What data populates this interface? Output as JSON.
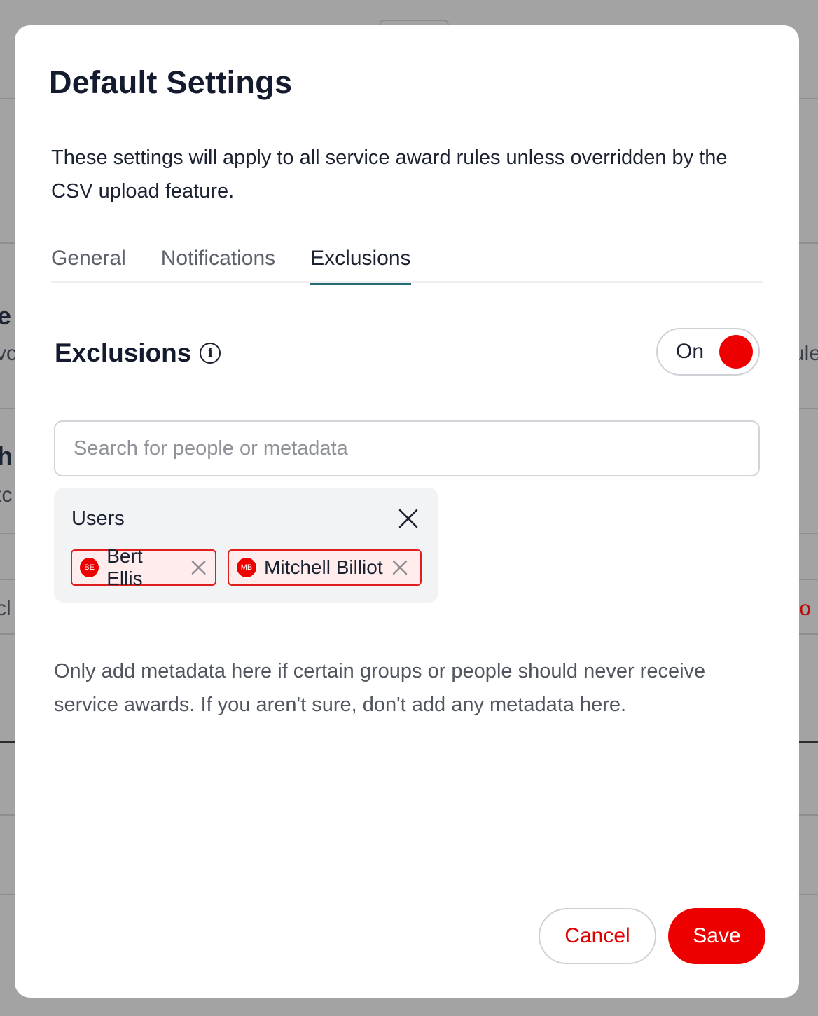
{
  "background": {
    "fragments": [
      "e",
      "vc",
      "ule",
      "h",
      "tc",
      "cl",
      "plo"
    ]
  },
  "modal": {
    "title": "Default Settings",
    "intro": "These settings will apply to all service award rules unless overridden by the CSV upload feature.",
    "tabs": [
      {
        "label": "General",
        "active": false
      },
      {
        "label": "Notifications",
        "active": false
      },
      {
        "label": "Exclusions",
        "active": true
      }
    ],
    "exclusions": {
      "title": "Exclusions",
      "info_icon": "info-icon",
      "toggle_label": "On",
      "toggle_on": true,
      "search_placeholder": "Search for people or metadata",
      "search_value": "",
      "group": {
        "title": "Users",
        "chips": [
          {
            "initials": "BE",
            "name": "Bert Ellis"
          },
          {
            "initials": "MB",
            "name": "Mitchell Billiot"
          }
        ]
      },
      "help": "Only add metadata here if certain groups or people should never receive service awards. If you aren't sure, don't add any metadata here."
    },
    "footer": {
      "cancel_label": "Cancel",
      "save_label": "Save"
    }
  },
  "colors": {
    "accent": "#ee0000",
    "tab_underline": "#236b72",
    "text": "#1b2232",
    "chip_bg": "#ffecec"
  }
}
